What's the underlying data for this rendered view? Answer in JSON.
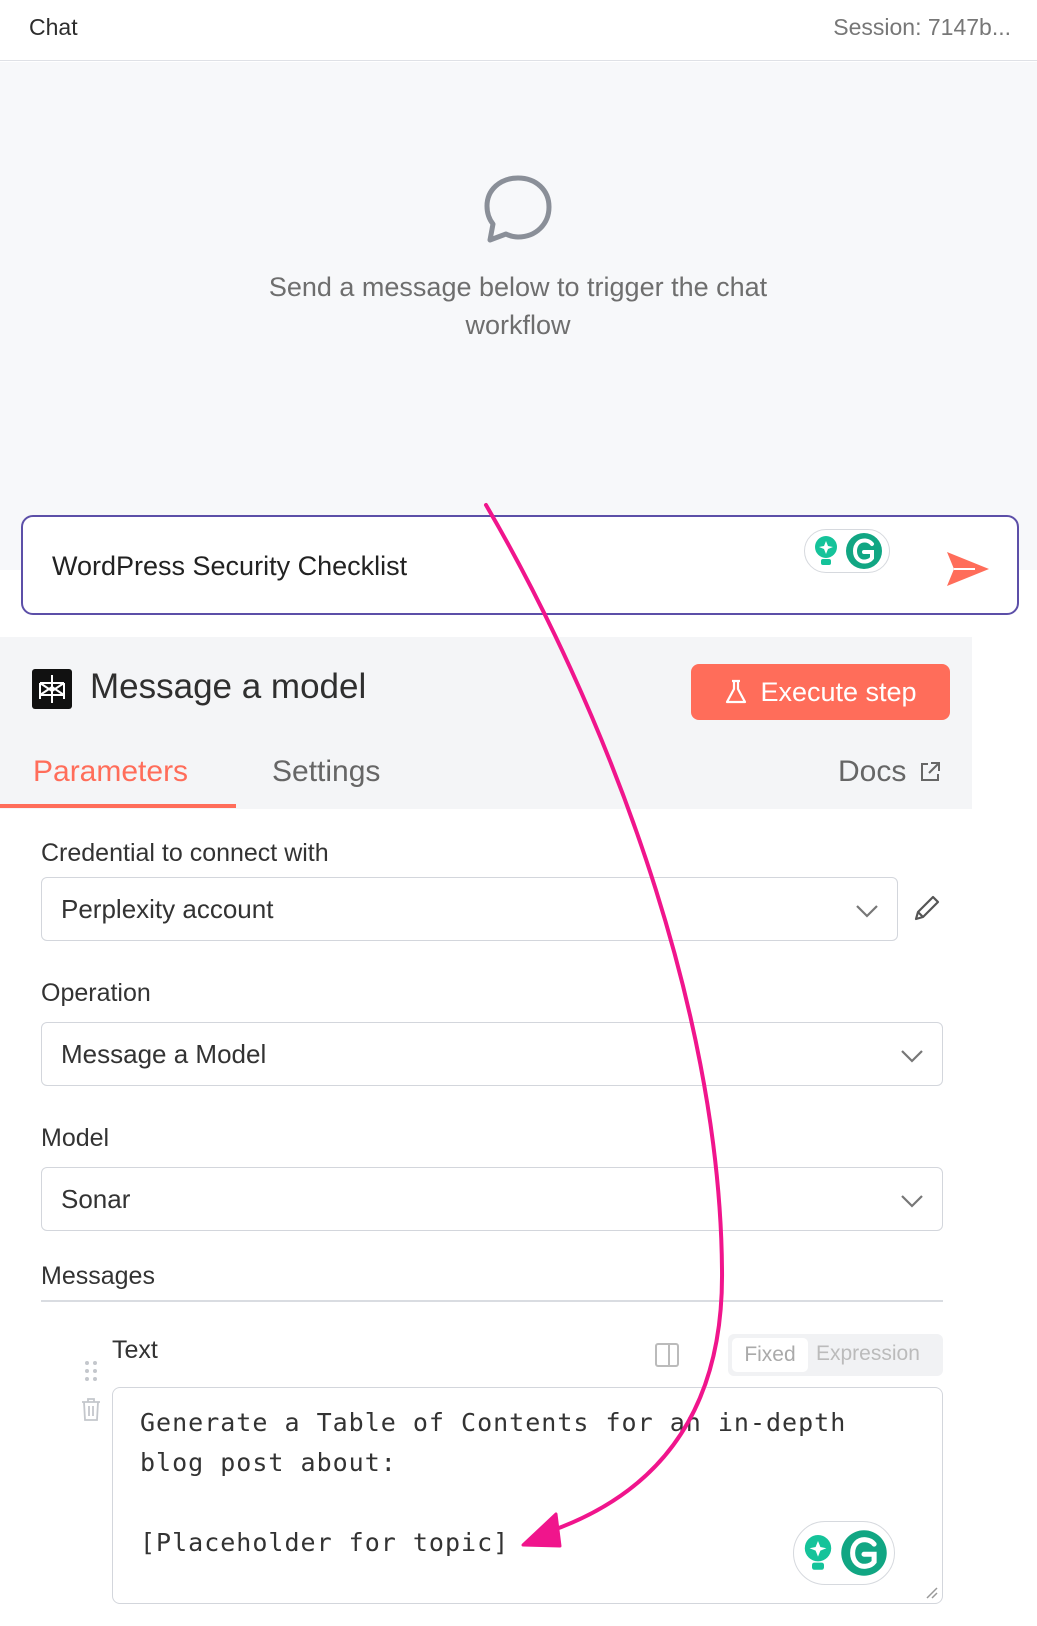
{
  "chat": {
    "title": "Chat",
    "session": "Session: 7147b...",
    "empty_message": "Send a message below to trigger the chat workflow",
    "input_value": "WordPress Security Checklist"
  },
  "node": {
    "title": "Message a model",
    "execute_label": "Execute step",
    "tabs": {
      "parameters": "Parameters",
      "settings": "Settings",
      "docs": "Docs"
    },
    "credential": {
      "label": "Credential to connect with",
      "value": "Perplexity account"
    },
    "operation": {
      "label": "Operation",
      "value": "Message a Model"
    },
    "model": {
      "label": "Model",
      "value": "Sonar"
    },
    "messages_label": "Messages",
    "text": {
      "label": "Text",
      "mode_fixed": "Fixed",
      "mode_expression": "Expression",
      "lines": [
        "Generate a Table of Contents for an in-depth",
        "blog post about:",
        "",
        "[Placeholder for topic]"
      ]
    }
  },
  "colors": {
    "accent": "#ff6d5a",
    "input_border": "#5c4fa8",
    "annotation_arrow": "#f0158c",
    "grammarly": "#15c39a"
  },
  "icons": [
    "chat-bubble-icon",
    "send-icon",
    "grammarly-icon",
    "bulb-icon",
    "perplexity-logo-icon",
    "flask-icon",
    "external-link-icon",
    "chevron-down-icon",
    "pencil-icon",
    "drag-handle-icon",
    "trash-icon",
    "expand-icon"
  ]
}
